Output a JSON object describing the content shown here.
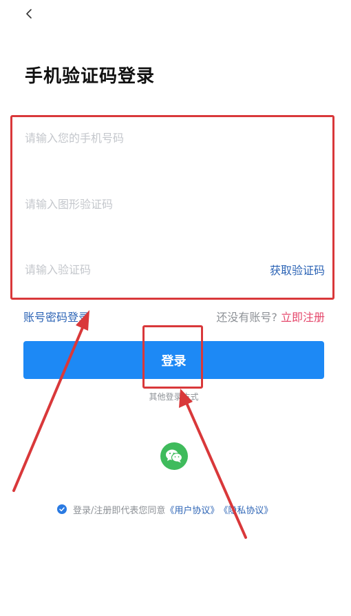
{
  "header": {
    "back_icon": "chevron-left-icon",
    "title": "手机验证码登录"
  },
  "form": {
    "phone_placeholder": "请输入您的手机号码",
    "captcha_placeholder": "请输入图形验证码",
    "sms_placeholder": "请输入验证码",
    "get_code_label": "获取验证码"
  },
  "links": {
    "password_login": "账号密码登录",
    "no_account": "还没有账号?",
    "register": "立即注册"
  },
  "login_button": "登录",
  "other_login": "其他登录方式",
  "social": {
    "wechat_icon": "wechat-icon"
  },
  "agreement": {
    "text": "登录/注册即代表您同意",
    "user_agreement": "《用户协议》",
    "privacy_agreement": "《隐私协议》",
    "checked": true
  },
  "colors": {
    "primary": "#1d89f5",
    "link": "#2b63b5",
    "register": "#e5476b",
    "wechat": "#3fbb5c",
    "annotation": "#d9383a"
  }
}
